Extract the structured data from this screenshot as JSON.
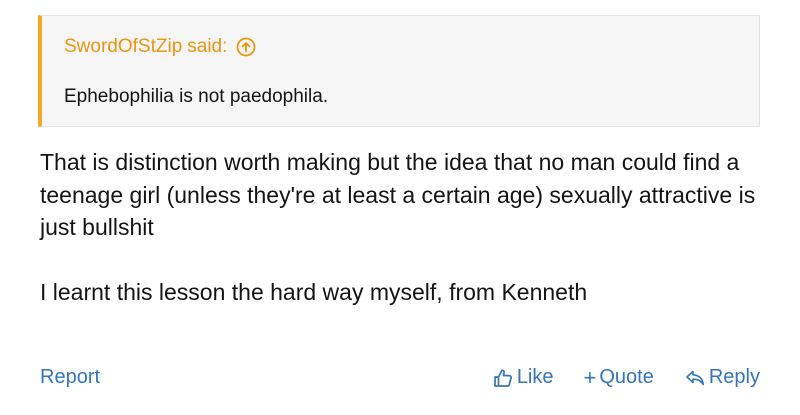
{
  "quote": {
    "author": "SwordOfStZip",
    "said_label": "said:",
    "text": "Ephebophilia is not paedophila.",
    "jump_icon": "arrow-up-circle-icon",
    "accent_color": "#f5a623"
  },
  "message": {
    "paragraphs": [
      "That is distinction worth making but the idea that no man could find a teenage girl (unless they're at least a certain age) sexually attractive is just bullshit",
      "I learnt this lesson the hard way myself, from Kenneth"
    ]
  },
  "footer": {
    "report_label": "Report",
    "like_label": "Like",
    "like_icon": "thumbs-up-icon",
    "quote_label": "Quote",
    "quote_icon": "plus-icon",
    "reply_label": "Reply",
    "reply_icon": "reply-arrow-icon",
    "link_color": "#3475b8"
  }
}
